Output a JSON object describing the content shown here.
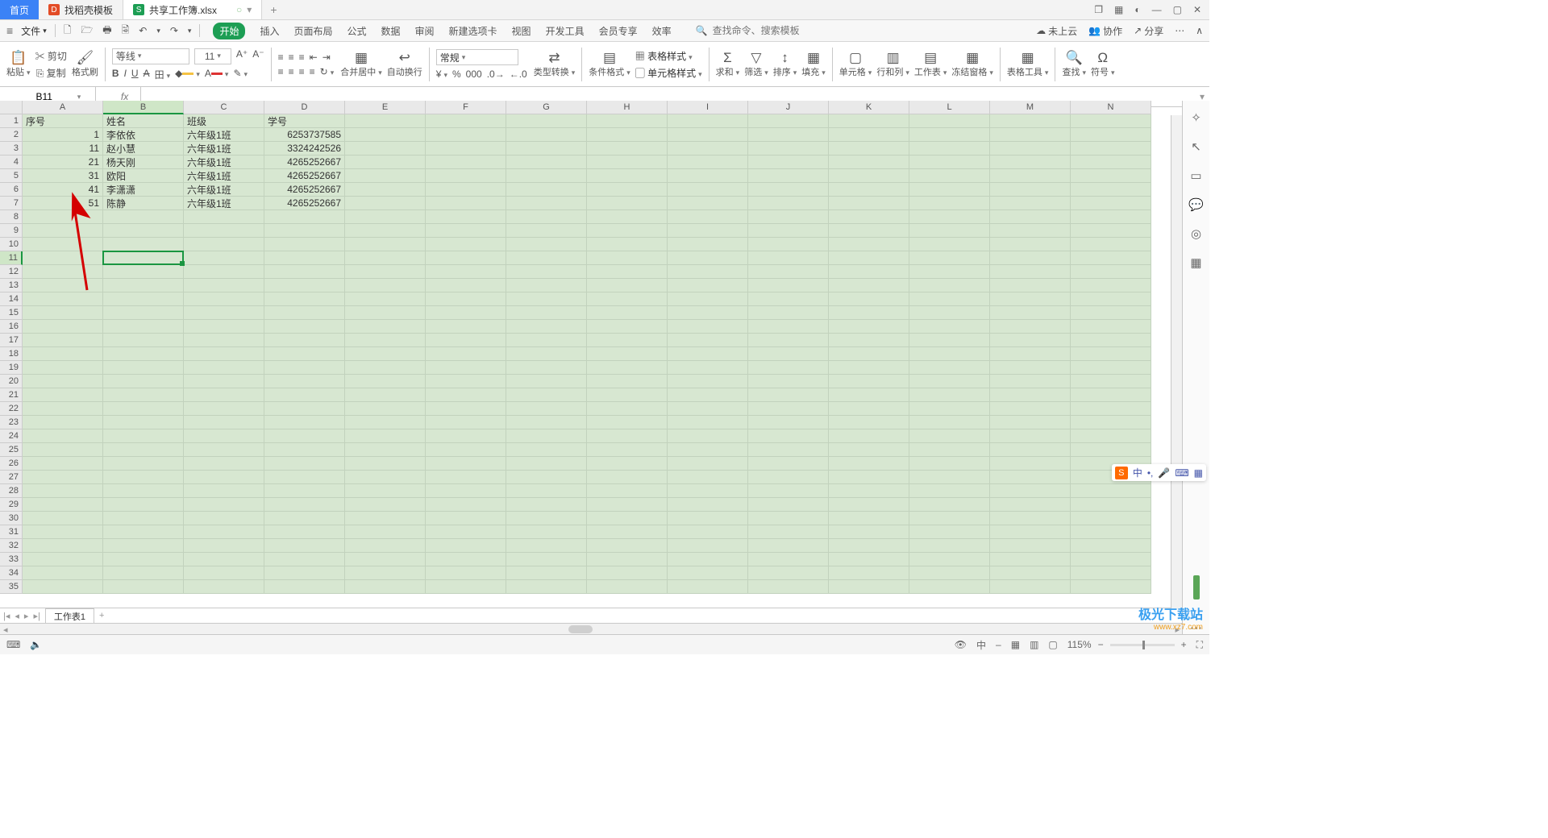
{
  "tabs": {
    "home": "首页",
    "doc1": "找稻壳模板",
    "doc2": "共享工作簿.xlsx",
    "addIcon": "+"
  },
  "winbtns": {
    "app": "❐",
    "grid": "▦",
    "user": "◐",
    "min": "—",
    "max": "▢",
    "close": "✕"
  },
  "filerow": {
    "fileLabel": "文件",
    "qat": {
      "new": "🗋",
      "open": "🗁",
      "print": "🖶",
      "preview": "🗟",
      "undo": "↶",
      "redo": "↷"
    },
    "tabs": [
      "开始",
      "插入",
      "页面布局",
      "公式",
      "数据",
      "审阅",
      "新建选项卡",
      "视图",
      "开发工具",
      "会员专享",
      "效率"
    ],
    "activeTab": 0,
    "searchIcon": "🔍",
    "searchPH": "查找命令、搜索模板",
    "cloud": "未上云",
    "coop": "协作",
    "share": "分享"
  },
  "ribbon": {
    "paste": "粘贴",
    "cut": "剪切",
    "copy": "复制",
    "fmtpaint": "格式刷",
    "font": "等线",
    "size": "11",
    "mergeCenter": "合并居中",
    "wrap": "自动换行",
    "numfmt": "常规",
    "typeconv": "类型转换",
    "condfmt": "条件格式",
    "tblstyle": "表格样式",
    "cellstyle": "单元格样式",
    "sum": "求和",
    "filter": "筛选",
    "sort": "排序",
    "fill": "填充",
    "cell": "单元格",
    "rowcol": "行和列",
    "sheet": "工作表",
    "freeze": "冻结窗格",
    "tbltool": "表格工具",
    "find": "查找",
    "symbol": "符号"
  },
  "fx": {
    "nameVal": "B11",
    "fxLabel": "fx"
  },
  "columns": [
    "A",
    "B",
    "C",
    "D",
    "E",
    "F",
    "G",
    "H",
    "I",
    "J",
    "K",
    "L",
    "M",
    "N"
  ],
  "rows": [
    "1",
    "2",
    "3",
    "4",
    "5",
    "6",
    "7",
    "8",
    "9",
    "10",
    "11",
    "12",
    "13",
    "14",
    "15",
    "16",
    "17",
    "18",
    "19",
    "20",
    "21",
    "22",
    "23",
    "24",
    "25",
    "26",
    "27",
    "28",
    "29",
    "30",
    "31",
    "32",
    "33",
    "34",
    "35"
  ],
  "header": {
    "A": "序号",
    "B": "姓名",
    "C": "班级",
    "D": "学号"
  },
  "data": [
    {
      "A": "1",
      "B": "李依依",
      "C": "六年级1班",
      "D": "6253737585"
    },
    {
      "A": "11",
      "B": "赵小慧",
      "C": "六年级1班",
      "D": "3324242526"
    },
    {
      "A": "21",
      "B": "杨天刚",
      "C": "六年级1班",
      "D": "4265252667"
    },
    {
      "A": "31",
      "B": "欧阳",
      "C": "六年级1班",
      "D": "4265252667"
    },
    {
      "A": "41",
      "B": "李潇潇",
      "C": "六年级1班",
      "D": "4265252667"
    },
    {
      "A": "51",
      "B": "陈静",
      "C": "六年级1班",
      "D": "4265252667"
    }
  ],
  "sheet": {
    "name": "工作表1",
    "add": "+"
  },
  "status": {
    "zoom": "115%",
    "eye": "👁",
    "cn": "中"
  },
  "ime": {
    "logo": "S",
    "cn": "中",
    "dot": "•,",
    "mic": "🎤",
    "kb": "⌨",
    "grid": "▦"
  },
  "watermark": {
    "t1": "极光下载站",
    "t2": "www.xz7.com"
  }
}
